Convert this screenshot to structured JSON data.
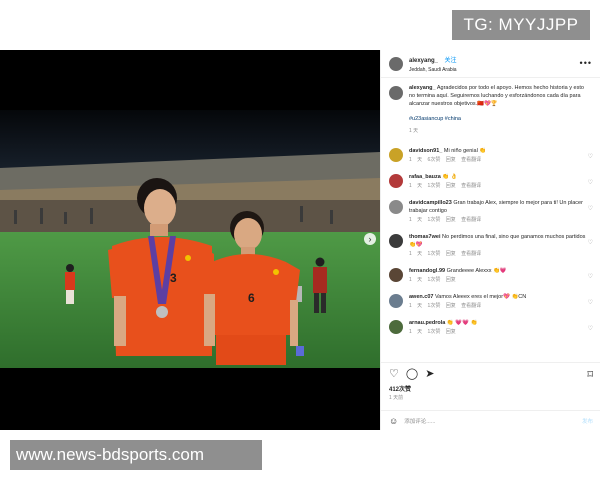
{
  "watermarks": {
    "top": "TG: MYYJJPP",
    "bottom": "www.news-bdsports.com"
  },
  "post": {
    "author": "alexyang_",
    "follow_label": "关注",
    "location": "Jeddah, Saudi Arabia",
    "caption": {
      "username": "alexyang_",
      "text": "Agradecidos por todo el apoyo. Hemos hecho historia y esto no termina aquí. Seguiremos luchando y esforzándonos cada día para alcanzar nuestros objetivos.🇨🇳💖🏆",
      "tags": "#u23asiancup #china",
      "time": "1 天"
    },
    "comments": [
      {
        "username": "davidson91_",
        "text": "Mi niño genial 👏",
        "meta": "1 天 6次赞 回复 查看翻译",
        "avatar_color": "#c9a227"
      },
      {
        "username": "rafaa_bauza",
        "text": "👏 👌",
        "meta": "1 天 1次赞 回复 查看翻译",
        "avatar_color": "#b33a3a"
      },
      {
        "username": "davidcampillo23",
        "text": "Gran trabajo Alex, siempre lo mejor para ti! Un placer trabajar contigo",
        "meta": "1 天 1次赞 回复 查看翻译",
        "avatar_color": "#8a8a8a"
      },
      {
        "username": "thomas7wei",
        "text": "No perdimos una final, sino que ganamos muchos partidos 👏💖",
        "meta": "1 天 1次赞 回复 查看翻译",
        "avatar_color": "#3b3b3b"
      },
      {
        "username": "fernandogl.99",
        "text": "Grandeeee Alexxx 👏💗",
        "meta": "1 天 1次赞 回复",
        "avatar_color": "#5a4636"
      },
      {
        "username": "awen.c07",
        "text": "Vamos Aleeex eres el mejor💖 👏CN",
        "meta": "1 天 1次赞 回复 查看翻译",
        "avatar_color": "#6b7d8f"
      },
      {
        "username": "arnau.pedrola",
        "text": "👏 💗💗 👏",
        "meta": "1 天 1次赞 回复",
        "avatar_color": "#4d6b3c"
      }
    ],
    "likes": "412次赞",
    "posted": "1 天前",
    "add_comment_placeholder": "添加评论......",
    "post_button": "发布"
  },
  "players": {
    "left_number": "3",
    "right_number": "6"
  },
  "colors": {
    "jersey": "#e8501c",
    "pitch": "#3f8a3a",
    "link": "#0095f6"
  }
}
